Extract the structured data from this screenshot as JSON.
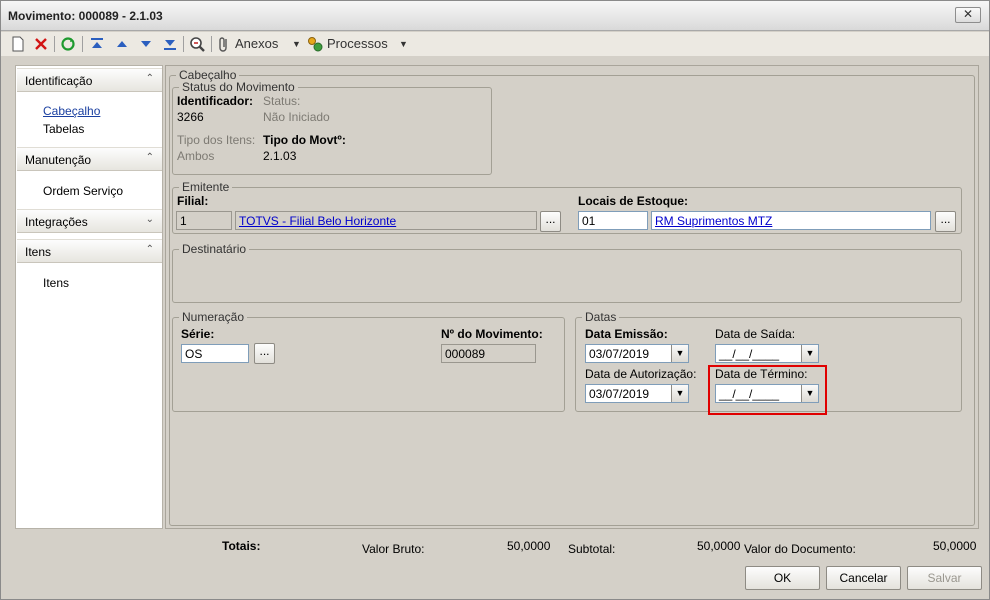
{
  "window": {
    "title": "Movimento: 000089 - 2.1.03",
    "close_label": "✕"
  },
  "toolbar": {
    "attachments_label": "Anexos",
    "processes_label": "Processos"
  },
  "sidebar": {
    "sections": [
      {
        "label": "Identificação",
        "chevron": "⌃",
        "items": [
          "Cabeçalho",
          "Tabelas"
        ]
      },
      {
        "label": "Manutenção",
        "chevron": "⌃",
        "items": [
          "Ordem Serviço"
        ]
      },
      {
        "label": "Integrações",
        "chevron": "⌄",
        "items": []
      },
      {
        "label": "Itens",
        "chevron": "⌃",
        "items": [
          "Itens"
        ]
      }
    ]
  },
  "header": {
    "legend": "Cabeçalho",
    "status_group": {
      "legend": "Status do Movimento",
      "identifier_label": "Identificador:",
      "identifier_value": "3266",
      "status_label": "Status:",
      "status_value": "Não Iniciado",
      "item_type_label": "Tipo dos Itens:",
      "item_type_value": "Ambos",
      "movt_type_label": "Tipo do Movtº:",
      "movt_type_value": "2.1.03"
    },
    "issuer": {
      "legend": "Emitente",
      "branch_label": "Filial:",
      "branch_code": "1",
      "branch_name": "TOTVS - Filial Belo Horizonte",
      "stock_label": "Locais de Estoque:",
      "stock_code": "01",
      "stock_name": "RM Suprimentos MTZ",
      "browse_label": "..."
    },
    "recipient": {
      "legend": "Destinatário"
    },
    "numbering": {
      "legend": "Numeração",
      "series_label": "Série:",
      "series_value": "OS",
      "movement_no_label": "Nº do Movimento:",
      "movement_no_value": "000089",
      "browse_label": "..."
    },
    "dates": {
      "legend": "Datas",
      "issue_label": "Data Emissão:",
      "issue_value": "03/07/2019",
      "exit_label": "Data de Saída:",
      "exit_value": "__/__/____",
      "auth_label": "Data de Autorização:",
      "auth_value": "03/07/2019",
      "end_label": "Data de Término:",
      "end_value": "__/__/____"
    }
  },
  "totals": {
    "label": "Totais:",
    "gross_label": "Valor Bruto:",
    "gross_value": "50,0000",
    "subtotal_label": "Subtotal:",
    "subtotal_value": "50,0000",
    "doc_label": "Valor do Documento:",
    "doc_value": "50,0000"
  },
  "buttons": {
    "ok": "OK",
    "cancel": "Cancelar",
    "save": "Salvar"
  },
  "colors": {
    "highlight": "#e00000",
    "link": "#0000cc"
  }
}
